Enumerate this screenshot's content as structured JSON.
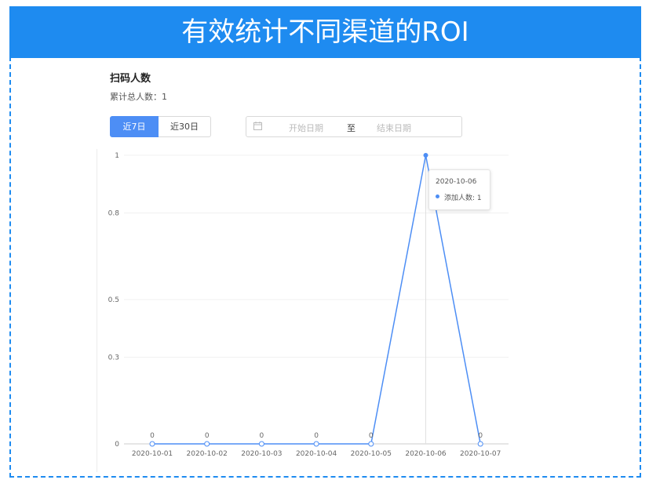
{
  "banner": {
    "title": "有效统计不同渠道的ROI"
  },
  "panel": {
    "title": "扫码人数",
    "total_label": "累计总人数：",
    "total_value": "1"
  },
  "range_tabs": [
    {
      "label": "近7日",
      "active": true
    },
    {
      "label": "近30日",
      "active": false
    }
  ],
  "date_range": {
    "start_placeholder": "开始日期",
    "separator": "至",
    "end_placeholder": "结束日期",
    "icon": "calendar-icon"
  },
  "tooltip": {
    "date": "2020-10-06",
    "series_label": "添加人数",
    "value": "1"
  },
  "colors": {
    "banner": "#1e8bf0",
    "accent": "#4d8ef5"
  },
  "chart_data": {
    "type": "line",
    "x": [
      "2020-10-01",
      "2020-10-02",
      "2020-10-03",
      "2020-10-04",
      "2020-10-05",
      "2020-10-06",
      "2020-10-07"
    ],
    "series": [
      {
        "name": "添加人数",
        "values": [
          0,
          0,
          0,
          0,
          0,
          1,
          0
        ]
      }
    ],
    "data_labels": [
      "0",
      "0",
      "0",
      "0",
      "0",
      "",
      "0"
    ],
    "y_ticks": [
      0,
      0.3,
      0.5,
      0.8,
      1
    ],
    "ylim": [
      0,
      1
    ],
    "grid": true,
    "title": "",
    "xlabel": "",
    "ylabel": ""
  }
}
